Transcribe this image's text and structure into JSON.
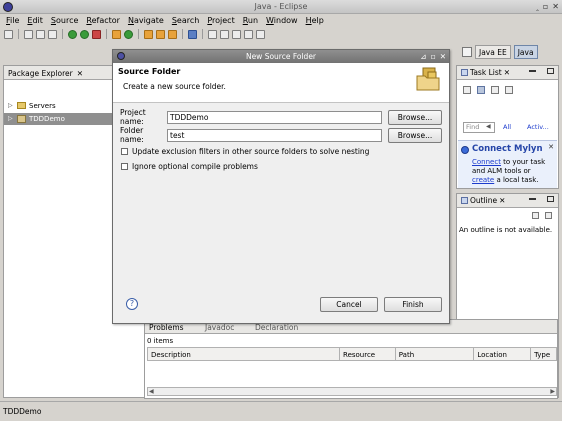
{
  "window": {
    "title": "Java - Eclipse",
    "buttons": [
      "‸",
      "▫",
      "✕"
    ]
  },
  "menu": [
    "File",
    "Edit",
    "Source",
    "Refactor",
    "Navigate",
    "Search",
    "Project",
    "Run",
    "Window",
    "Help"
  ],
  "perspectives": [
    {
      "label": "Java EE",
      "active": false
    },
    {
      "label": "Java",
      "active": true
    }
  ],
  "package_explorer": {
    "tab_label": "Package Explorer",
    "close": "✕",
    "items": [
      {
        "label": "Servers",
        "expander": "▷"
      },
      {
        "label": "TDDDemo",
        "expander": "▷",
        "selected": true
      }
    ]
  },
  "task_list": {
    "tab_label": "Task List",
    "close": "✕",
    "find_placeholder": "Find",
    "all_label": "All",
    "activate_label": "Activ...",
    "mylyn": {
      "title": "Connect Mylyn",
      "close": "✕",
      "text_connect": "Connect",
      "text_mid": " to your task and ALM tools or ",
      "text_create": "create",
      "text_end": " a local task."
    }
  },
  "outline": {
    "tab_label": "Outline",
    "close": "✕",
    "message": "An outline is not available."
  },
  "problems": {
    "tabs": [
      "Problems",
      "Javadoc",
      "Declaration"
    ],
    "count": "0 items",
    "columns": [
      "Description",
      "Resource",
      "Path",
      "Location",
      "Type"
    ]
  },
  "status": {
    "text": "TDDDemo"
  },
  "dialog": {
    "title": "New Source Folder",
    "buttons": [
      "⊿",
      "▫",
      "✕"
    ],
    "header_title": "Source Folder",
    "header_message": "Create a new source folder.",
    "project_name_label": "Project name:",
    "project_name_value": "TDDDemo",
    "folder_name_label": "Folder name:",
    "folder_name_value": "test",
    "browse_label": "Browse...",
    "checkbox_update": "Update exclusion filters in other source folders to solve nesting",
    "checkbox_ignore": "Ignore optional compile problems",
    "help": "?",
    "cancel_label": "Cancel",
    "finish_label": "Finish"
  }
}
